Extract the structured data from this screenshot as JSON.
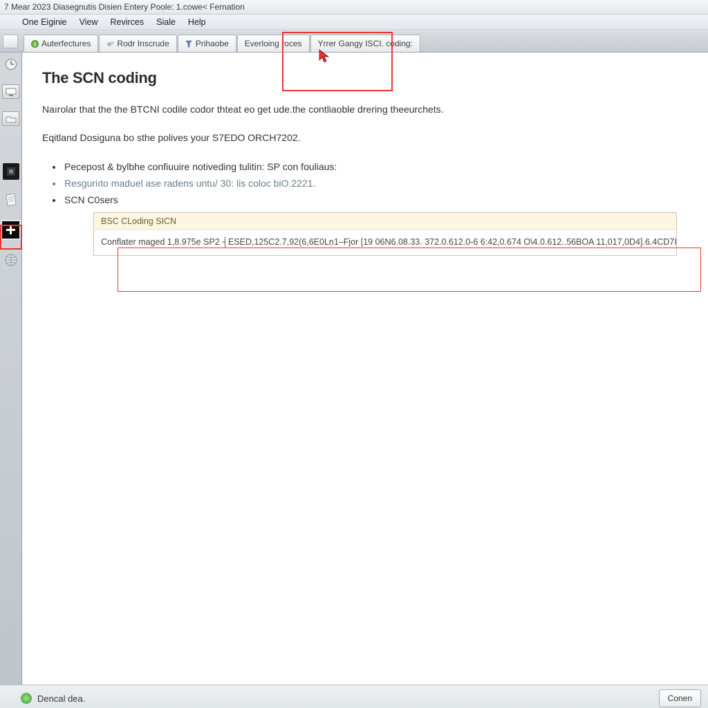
{
  "window": {
    "title": "7 Mear 2023  Diasegnutis Disien Entery Poole: 1.cowe< Fernation"
  },
  "menu": {
    "items": [
      "One Eiginie",
      "View",
      "Revirces",
      "Siale",
      "Help"
    ]
  },
  "tabs": [
    {
      "label": "Auterfectures"
    },
    {
      "label": "Rodr Inscrude"
    },
    {
      "label": "Prihaobe"
    },
    {
      "label": "Everloing roces"
    },
    {
      "label": "Yrrer Gangy ISCI. coding:"
    }
  ],
  "page": {
    "title": "The SCN coding",
    "para1": "Naırolar that the the BTCNI codile codor thteat eo get ude.the contliaoble drering theeurchets.",
    "para2": "Eqitland Dosiguna bo sthe polives your S7EDO ORCH7202.",
    "bullets": [
      "Pecepost & bylbhe confiuuire notiveding tulitin: SP con fouliaus:",
      "Resguriıto maduel ase radens untu/ 30: lis coloc biO.2221.",
      "SCN C0sers"
    ],
    "output": {
      "header": "BSC CLoding SICN",
      "body": "Conflater maged 1,8.975e SP2 ┤ESED,125C2.7,92(6,6E0Lṇ1–Fjor [19 06N6.08.33. 372.0.612.0-6 6:42,0.674 O\\4.0.612..56BOA 11,017,0D4].6.4CD7I"
    }
  },
  "footer": {
    "left_label": "Dencal dea.",
    "right_button": "Conen"
  },
  "icons": {
    "tab0": "info-icon",
    "tab1": "gear-pair-icon",
    "tab2": "filter-icon",
    "tab3": "",
    "tab4": ""
  }
}
